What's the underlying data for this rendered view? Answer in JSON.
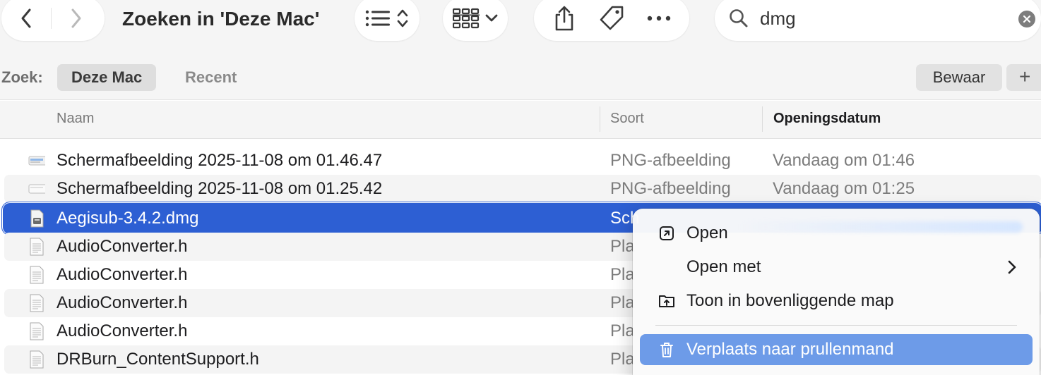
{
  "window": {
    "title": "Zoeken in 'Deze Mac'"
  },
  "toolbar": {
    "back_icon": "chevron-left-icon",
    "forward_icon": "chevron-right-icon",
    "view_icon": "list-view-icon",
    "group_icon": "grid-view-icon",
    "share_icon": "share-icon",
    "tag_icon": "tag-icon",
    "more_icon": "ellipsis-icon"
  },
  "search": {
    "value": "dmg",
    "icon": "magnifier-icon",
    "clear_icon": "clear-icon"
  },
  "scope": {
    "label": "Zoek:",
    "options": [
      "Deze Mac",
      "Recent"
    ],
    "active": "Deze Mac",
    "save_label": "Bewaar",
    "add_label": "+"
  },
  "columns": {
    "name": "Naam",
    "kind": "Soort",
    "date": "Openingsdatum",
    "sorted_by": "Openingsdatum"
  },
  "files": [
    {
      "name": "Schermafbeelding 2025-11-08 om 01.46.47",
      "kind": "PNG-afbeelding",
      "date": "Vandaag om 01:46",
      "icon": "image-file-icon"
    },
    {
      "name": "Schermafbeelding 2025-11-08 om 01.25.42",
      "kind": "PNG-afbeelding",
      "date": "Vandaag om 01:25",
      "icon": "image-file-icon"
    },
    {
      "name": "Aegisub-3.4.2.dmg",
      "kind": "Sch",
      "date": "",
      "icon": "disk-image-icon",
      "selected": true
    },
    {
      "name": "AudioConverter.h",
      "kind": "Pla",
      "date": "",
      "icon": "text-file-icon"
    },
    {
      "name": "AudioConverter.h",
      "kind": "Pla",
      "date": "",
      "icon": "text-file-icon"
    },
    {
      "name": "AudioConverter.h",
      "kind": "Pla",
      "date": "",
      "icon": "text-file-icon"
    },
    {
      "name": "AudioConverter.h",
      "kind": "Pla",
      "date": "",
      "icon": "text-file-icon"
    },
    {
      "name": "DRBurn_ContentSupport.h",
      "kind": "Pla",
      "date": "",
      "icon": "text-file-icon"
    }
  ],
  "context_menu": {
    "items": [
      {
        "label": "Open",
        "icon": "open-arrow-icon"
      },
      {
        "label": "Open met",
        "icon": "",
        "submenu_icon": "chevron-right-icon"
      },
      {
        "label": "Toon in bovenliggende map",
        "icon": "folder-up-icon"
      },
      {
        "label": "Verplaats naar prullenmand",
        "icon": "trash-icon",
        "highlighted": true
      }
    ]
  },
  "colors": {
    "selection": "#2d5fd3",
    "menu_highlight": "#6d9be8",
    "toolbar_bg": "#f5f5f5",
    "stripe": "#f4f4f4"
  }
}
